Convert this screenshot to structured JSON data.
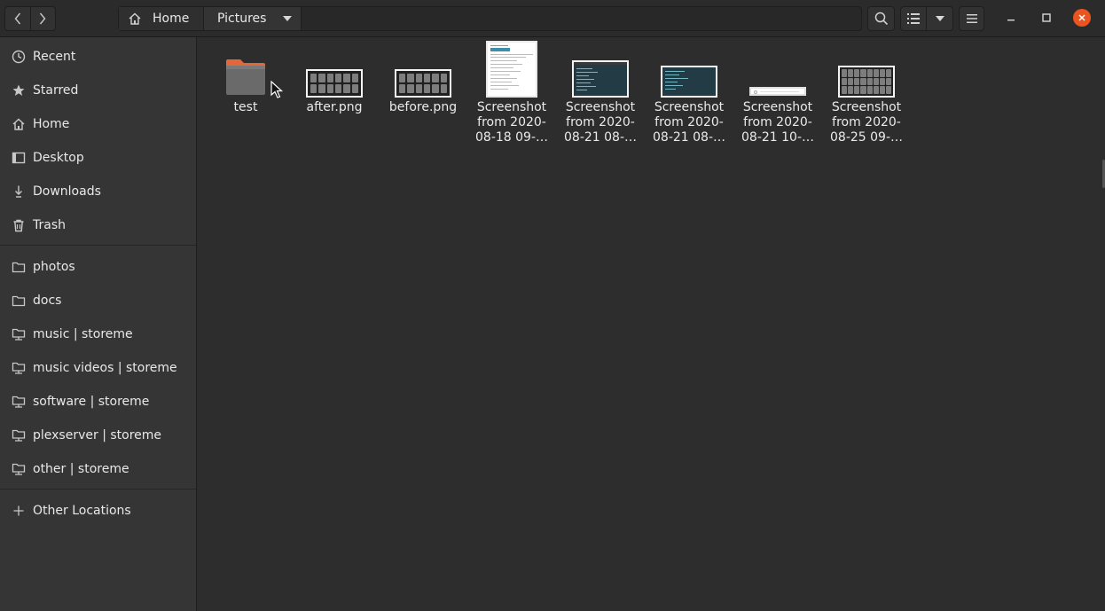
{
  "header": {
    "breadcrumbs": [
      {
        "label": "Home",
        "icon": "home-icon"
      },
      {
        "label": "Pictures",
        "icon": "chevron-down-icon"
      }
    ],
    "icons": {
      "back": "chevron-left-icon",
      "forward": "chevron-right-icon",
      "search": "search-icon",
      "view": "list-view-icon",
      "view_options": "chevron-down-icon",
      "menu": "hamburger-menu-icon",
      "minimize": "minimize-icon",
      "maximize": "maximize-icon",
      "close": "close-icon"
    }
  },
  "sidebar": {
    "places": [
      {
        "label": "Recent",
        "icon": "clock-icon"
      },
      {
        "label": "Starred",
        "icon": "star-icon"
      },
      {
        "label": "Home",
        "icon": "home-icon"
      },
      {
        "label": "Desktop",
        "icon": "desktop-icon"
      },
      {
        "label": "Downloads",
        "icon": "download-icon"
      },
      {
        "label": "Trash",
        "icon": "trash-icon"
      }
    ],
    "bookmarks": [
      {
        "label": "photos",
        "icon": "folder-icon"
      },
      {
        "label": "docs",
        "icon": "folder-icon"
      },
      {
        "label": "music | storeme",
        "icon": "network-folder-icon"
      },
      {
        "label": "music videos | storeme",
        "icon": "network-folder-icon"
      },
      {
        "label": "software | storeme",
        "icon": "network-folder-icon"
      },
      {
        "label": "plexserver | storeme",
        "icon": "network-folder-icon"
      },
      {
        "label": "other | storeme",
        "icon": "network-folder-icon"
      }
    ],
    "other": {
      "label": "Other Locations",
      "icon": "plus-icon"
    }
  },
  "files": [
    {
      "label": "test",
      "kind": "folder"
    },
    {
      "label": "after.png",
      "kind": "image-grid"
    },
    {
      "label": "before.png",
      "kind": "image-grid"
    },
    {
      "label": "Screenshot from 2020-08-18 09-…",
      "kind": "document"
    },
    {
      "label": "Screenshot from 2020-08-21 08-…",
      "kind": "terminal"
    },
    {
      "label": "Screenshot from 2020-08-21 08-…",
      "kind": "terminal"
    },
    {
      "label": "Screenshot from 2020-08-21 10-…",
      "kind": "bar"
    },
    {
      "label": "Screenshot from 2020-08-25 09-…",
      "kind": "image-grid"
    }
  ],
  "colors": {
    "folder": "#e2673a",
    "accent_close": "#e95420"
  }
}
